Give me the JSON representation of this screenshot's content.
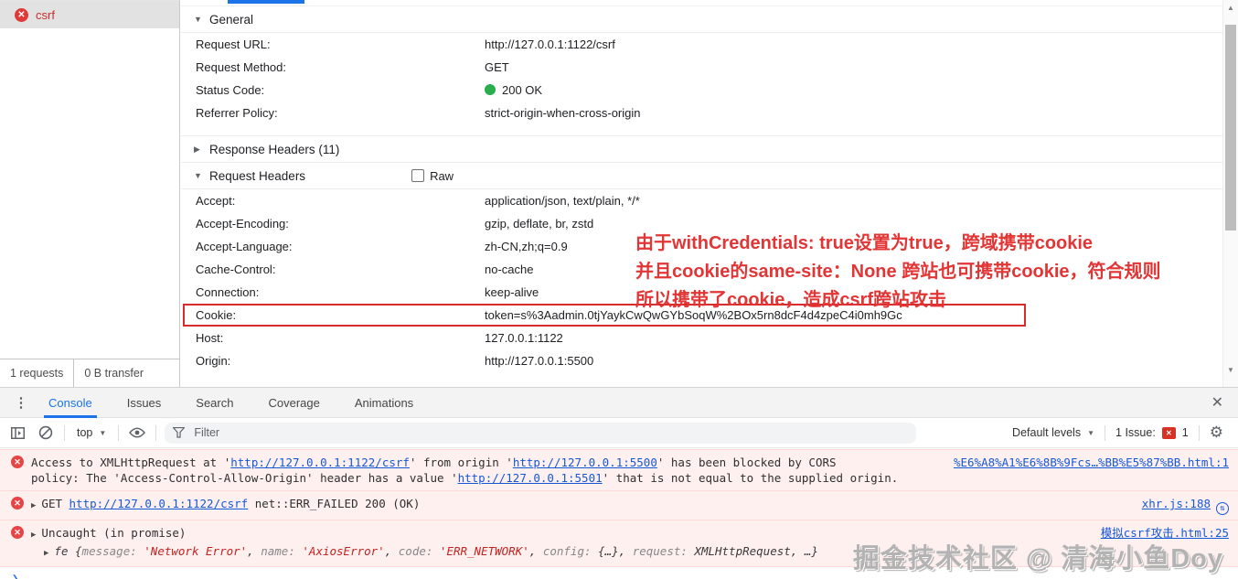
{
  "colors": {
    "accent": "#1a73e8",
    "error_red": "#d93025",
    "status_green": "#2aad4c",
    "link_blue": "#1558d6",
    "annotation_red": "#e23535"
  },
  "network": {
    "sidebar": {
      "request_name": "csrf",
      "requests_count": "1 requests",
      "transfer": "0 B transfer"
    },
    "general": {
      "title": "General",
      "rows": [
        {
          "label": "Request URL:",
          "value": "http://127.0.0.1:1122/csrf"
        },
        {
          "label": "Request Method:",
          "value": "GET"
        },
        {
          "label": "Status Code:",
          "value": "200 OK"
        },
        {
          "label": "Referrer Policy:",
          "value": "strict-origin-when-cross-origin"
        }
      ]
    },
    "response_headers": {
      "title": "Response Headers (11)"
    },
    "request_headers": {
      "title": "Request Headers",
      "raw_label": "Raw",
      "rows": [
        {
          "label": "Accept:",
          "value": "application/json, text/plain, */*"
        },
        {
          "label": "Accept-Encoding:",
          "value": "gzip, deflate, br, zstd"
        },
        {
          "label": "Accept-Language:",
          "value": "zh-CN,zh;q=0.9"
        },
        {
          "label": "Cache-Control:",
          "value": "no-cache"
        },
        {
          "label": "Connection:",
          "value": "keep-alive"
        },
        {
          "label": "Cookie:",
          "value": "token=s%3Aadmin.0tjYaykCwQwGYbSoqW%2BOx5rn8dcF4d4zpeC4i0mh9Gc"
        },
        {
          "label": "Host:",
          "value": "127.0.0.1:1122"
        },
        {
          "label": "Origin:",
          "value": "http://127.0.0.1:5500"
        }
      ]
    },
    "annotation": {
      "line1": "由于withCredentials: true设置为true，跨域携带cookie",
      "line2": "并且cookie的same-site：None 跨站也可携带cookie，符合规则",
      "line3": "所以携带了cookie，造成csrf跨站攻击"
    }
  },
  "drawer": {
    "tabs": {
      "console": "Console",
      "issues": "Issues",
      "search": "Search",
      "coverage": "Coverage",
      "animations": "Animations"
    },
    "toolbar": {
      "context": "top",
      "filter_placeholder": "Filter",
      "levels_label": "Default levels",
      "issues_label": "1 Issue:",
      "issues_count": "1"
    },
    "console": {
      "msg1": {
        "t1": "Access to XMLHttpRequest at '",
        "link1": "http://127.0.0.1:1122/csrf",
        "t2": "' from origin '",
        "link2": "http://127.0.0.1:5500",
        "t3": "' has been blocked by CORS",
        "t4": "policy: The 'Access-Control-Allow-Origin' header has a value '",
        "link3": "http://127.0.0.1:5501",
        "t5": "' that is not equal to the supplied origin.",
        "source": "%E6%A8%A1%E6%8B%9Fcs…%BB%E5%87%BB.html:1"
      },
      "msg2": {
        "t1": "GET ",
        "link1": "http://127.0.0.1:1122/csrf",
        "t2": " net::ERR_FAILED 200 (OK)",
        "source": "xhr.js:188"
      },
      "msg3": {
        "line1": "Uncaught (in promise)",
        "source": "模拟csrf攻击.html:25",
        "obj": "fe",
        "b1": " {",
        "k1": "message: ",
        "v1": "'Network Error'",
        "c1": ", ",
        "k2": "name: ",
        "v2": "'AxiosError'",
        "c2": ", ",
        "k3": "code: ",
        "v3": "'ERR_NETWORK'",
        "c3": ", ",
        "k4": "config: ",
        "v4": "{…}",
        "c4": ", ",
        "k5": "request: ",
        "v5": "XMLHttpRequest",
        "c5": ", ",
        "end": "…}"
      },
      "watermark": "掘金技术社区 @ 清海小鱼Doy"
    }
  }
}
